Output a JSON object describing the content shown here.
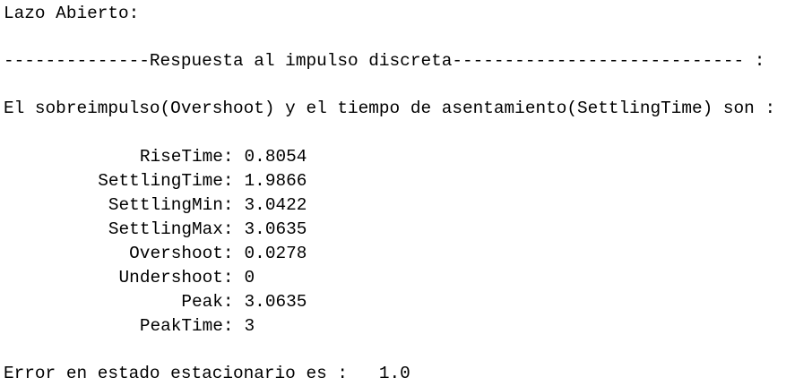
{
  "console": {
    "heading": "Lazo Abierto:",
    "section_header": "--------------Respuesta al impulso discreta---------------------------- :",
    "intro": "El sobreimpulso(Overshoot) y el tiempo de asentamiento(SettlingTime) son :",
    "metrics": [
      {
        "name": "RiseTime:",
        "value": "0.8054"
      },
      {
        "name": "SettlingTime:",
        "value": "1.9866"
      },
      {
        "name": "SettlingMin:",
        "value": "3.0422"
      },
      {
        "name": "SettlingMax:",
        "value": "3.0635"
      },
      {
        "name": "Overshoot:",
        "value": "0.0278"
      },
      {
        "name": "Undershoot:",
        "value": "0"
      },
      {
        "name": "Peak:",
        "value": "3.0635"
      },
      {
        "name": "PeakTime:",
        "value": "3"
      }
    ],
    "error_line": "Error en estado estacionario es :   1.0"
  }
}
